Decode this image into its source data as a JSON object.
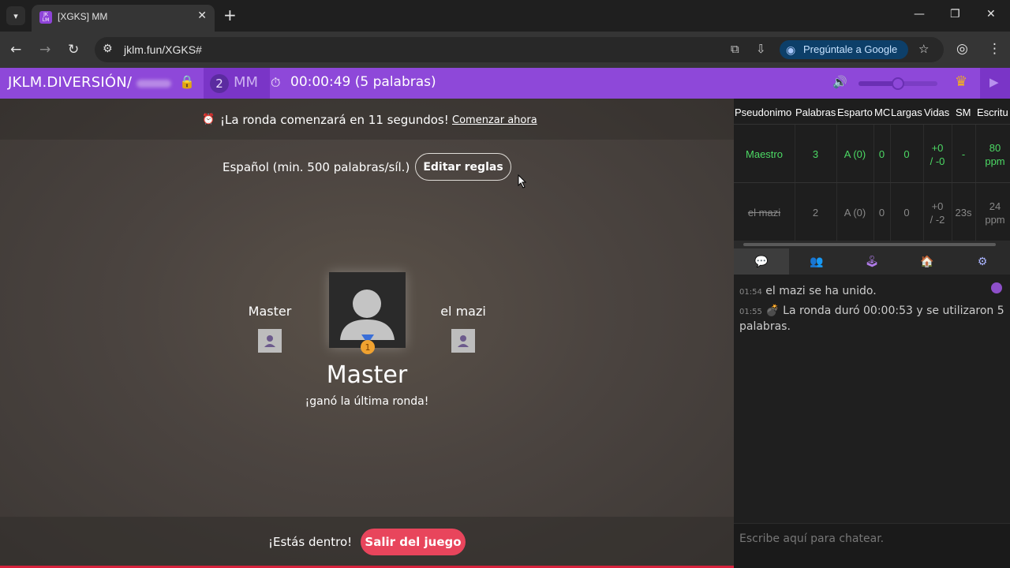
{
  "browser": {
    "tab_title": "[XGKS] MM",
    "favicon_text": "JK LM",
    "url": "jklm.fun/XGKS#",
    "ask_google": "Pregúntale a Google"
  },
  "header": {
    "brand": "JKLM.DIVERSIÓN/",
    "room_count": "2",
    "room_name": "MM",
    "timer": "00:00:49 (5 palabras)",
    "volume_level": 0.5
  },
  "game": {
    "round_message": "¡La ronda comenzará en 11 segundos!",
    "start_now": "Comenzar ahora",
    "language": "Español (min. 500 palabras/síl.)",
    "edit_rules": "Editar reglas",
    "player_left": "Master",
    "player_right": "el mazi",
    "medal_number": "1",
    "winner_name": "Master",
    "winner_msg": "¡ganó la última ronda!",
    "inside_msg": "¡Estás dentro!",
    "leave_button": "Salir del juego"
  },
  "scoreboard": {
    "headers": [
      "Pseudonimo",
      "Palabras",
      "Esparto",
      "MC",
      "Largas",
      "Vidas",
      "SM",
      "Escritu"
    ],
    "rows": [
      {
        "name": "Maestro",
        "words": "3",
        "esparto": "A (0)",
        "mc": "0",
        "largas": "0",
        "vidas_a": "+0",
        "vidas_b": "/ -0",
        "sm": "-",
        "esc_a": "80",
        "esc_b": "ppm"
      },
      {
        "name": "el mazi",
        "words": "2",
        "esparto": "A (0)",
        "mc": "0",
        "largas": "0",
        "vidas_a": "+0",
        "vidas_b": "/ -2",
        "sm": "23s",
        "esc_a": "24",
        "esc_b": "ppm"
      }
    ]
  },
  "chat": {
    "messages": [
      {
        "time": "01:54",
        "text": "el mazi se ha unido."
      },
      {
        "time": "01:55",
        "text": "La ronda duró 00:00:53 y se utilizaron 5 palabras."
      }
    ],
    "placeholder": "Escribe aquí para chatear."
  },
  "colors": {
    "header": "#8e48d9",
    "leave_button": "#e8455c",
    "active_player": "#4cd964"
  }
}
